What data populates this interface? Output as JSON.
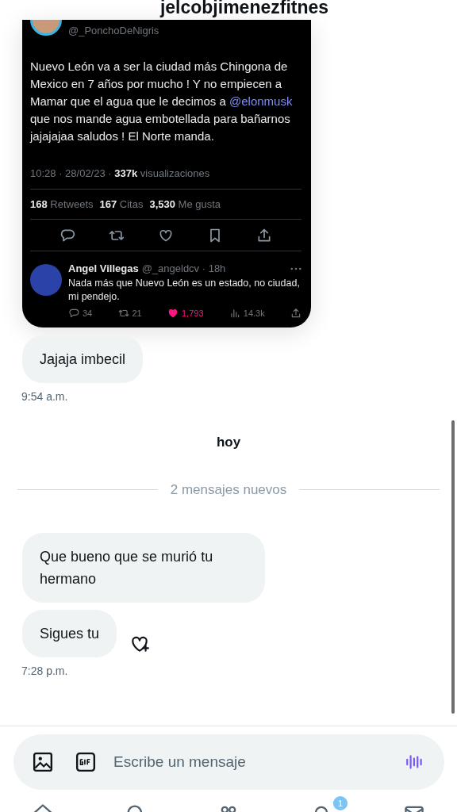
{
  "header": {
    "title": "jelcobjimenezfitnes"
  },
  "shared_tweet": {
    "handle": "@_PonchoDeNigris",
    "text_parts": [
      {
        "kind": "text",
        "text": "Nuevo León va a ser la ciudad más Chingona de Mexico en 7 años por mucho ! Y no empiecen a Mamar que el agua que le decimos a "
      },
      {
        "kind": "mention",
        "text": "@elonmusk"
      },
      {
        "kind": "text",
        "text": " que nos mande agua embotellada para bañarnos jajajajaa saludos ! El Norte manda."
      }
    ],
    "timestamp": "10:28 · 28/02/23 ·",
    "views_count": "337k",
    "views_label": "visualizaciones",
    "stats": [
      {
        "count": "168",
        "label": "Retweets"
      },
      {
        "count": "167",
        "label": "Citas"
      },
      {
        "count": "3,530",
        "label": "Me gusta"
      }
    ],
    "actions": [
      {
        "kind": "reply"
      },
      {
        "kind": "retweet"
      },
      {
        "kind": "like"
      },
      {
        "kind": "bookmark"
      },
      {
        "kind": "share"
      }
    ],
    "reply": {
      "name": "Angel Villegas",
      "handle": "@_angeldcv · 18h",
      "text": "Nada más que Nuevo León es un estado, no ciudad, mi pendejo.",
      "actions": [
        {
          "kind": "reply",
          "count": "34"
        },
        {
          "kind": "retweet",
          "count": "21"
        },
        {
          "kind": "like",
          "count": "1,793",
          "liked": true
        },
        {
          "kind": "views",
          "count": "14.3k"
        },
        {
          "kind": "share"
        }
      ]
    }
  },
  "chat": [
    {
      "kind": "message",
      "text": "Jajaja imbecil"
    },
    {
      "kind": "time",
      "text": "9:54 a.m."
    },
    {
      "kind": "day",
      "text": "hoy"
    },
    {
      "kind": "divider",
      "text": "2 mensajes nuevos"
    },
    {
      "kind": "message",
      "text": "Que bueno que se murió tu hermano"
    },
    {
      "kind": "message",
      "text": "Sigues tu",
      "reaction_button": true
    },
    {
      "kind": "time",
      "text": "7:28 p.m."
    }
  ],
  "composer": {
    "placeholder": "Escribe un mensaje"
  },
  "bottom_nav": [
    {
      "kind": "home"
    },
    {
      "kind": "search"
    },
    {
      "kind": "communities"
    },
    {
      "kind": "notifications",
      "badge": "1"
    },
    {
      "kind": "messages"
    }
  ]
}
